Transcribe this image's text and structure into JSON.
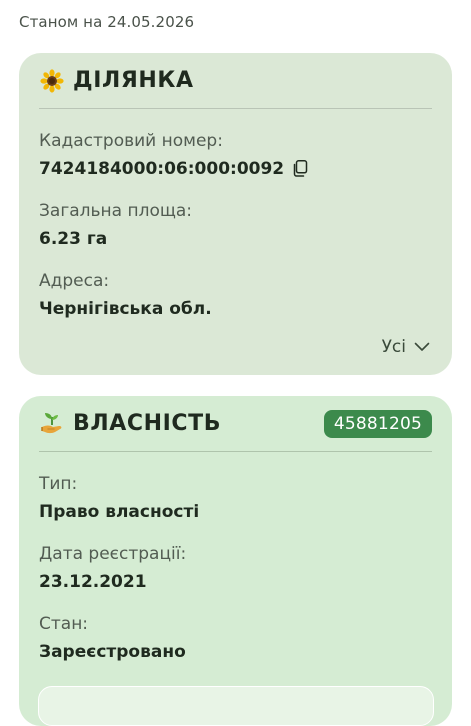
{
  "as_of": "Станом на 24.05.2026",
  "plot_card": {
    "icon": "sunflower-icon",
    "title": "ДІЛЯНКА",
    "fields": [
      {
        "label": "Кадастровий номер:",
        "value": "7424184000:06:000:0092"
      },
      {
        "label": "Загальна площа:",
        "value": "6.23 га"
      },
      {
        "label": "Адреса:",
        "value": "Чернігівська обл."
      }
    ],
    "more_label": "Усі"
  },
  "ownership_card": {
    "icon": "seedling-hand-icon",
    "title": "ВЛАСНІСТЬ",
    "badge": "45881205",
    "fields": [
      {
        "label": "Тип:",
        "value": "Право власності"
      },
      {
        "label": "Дата реєстрації:",
        "value": "23.12.2021"
      },
      {
        "label": "Стан:",
        "value": "Зареєстровано"
      }
    ]
  },
  "colors": {
    "plot_card_bg": "#dbe8d6",
    "ownership_card_bg": "#d5ecd3",
    "badge_bg": "#3c8a4c"
  }
}
